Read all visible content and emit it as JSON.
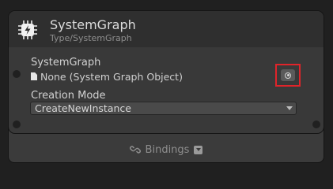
{
  "node": {
    "title": "SystemGraph",
    "subtitle": "Type/SystemGraph",
    "icon": "circuit-chip-icon"
  },
  "fields": {
    "system_graph": {
      "label": "SystemGraph",
      "value": "None (System Graph Object)",
      "value_icon": "document-icon",
      "picker_icon": "object-picker-icon"
    },
    "creation_mode": {
      "label": "Creation Mode",
      "value": "CreateNewInstance",
      "arrow_icon": "chevron-down-icon"
    }
  },
  "bindings": {
    "label": "Bindings",
    "icon": "link-icon",
    "toggle_icon": "checkbox-dropdown-icon"
  },
  "colors": {
    "background": "#202020",
    "node_body": "#393939",
    "node_header": "#2f2f2f",
    "highlight_border": "#e0242a",
    "stripe": "#5c4d20"
  }
}
